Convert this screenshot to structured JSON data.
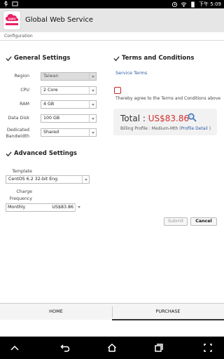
{
  "status": {
    "time": "下午 5:09"
  },
  "app": {
    "title": "Global Web Service",
    "logo_text": "GWS"
  },
  "breadcrumb": "Configuration",
  "general": {
    "title": "General Settings",
    "rows": [
      {
        "label": "Region",
        "value": "Taiwan",
        "disabled": true
      },
      {
        "label": "CPU",
        "value": "2 Core"
      },
      {
        "label": "RAM",
        "value": "4 GB"
      },
      {
        "label": "Data Disk",
        "value": "100 GB"
      },
      {
        "label": "Dedicated Bandwidth",
        "value": "Shared"
      }
    ]
  },
  "advanced": {
    "title": "Advanced Settings",
    "template_label": "Template",
    "template_value": "CentOS 6.2 32-bit Eng",
    "charge_label": "Charge Frequency",
    "charge_value": "Monthly",
    "charge_price": "US$83.86"
  },
  "terms": {
    "title": "Terms and Conditions",
    "link": "Service Terms",
    "agree_text": "Thereby agree to the Terms and Conditions above"
  },
  "total": {
    "label": "Total : ",
    "value": "US$83.86",
    "billing_prefix": "Billing Profile : Medium-Mth (",
    "billing_link": "Profile Detail",
    "billing_suffix": " )"
  },
  "buttons": {
    "submit": "Submit",
    "cancel": "Cancel"
  },
  "tabs": {
    "home": "HOME",
    "purchase": "PURCHASE"
  },
  "colors": {
    "accent": "#d32f2f",
    "link": "#2b5aa6"
  }
}
